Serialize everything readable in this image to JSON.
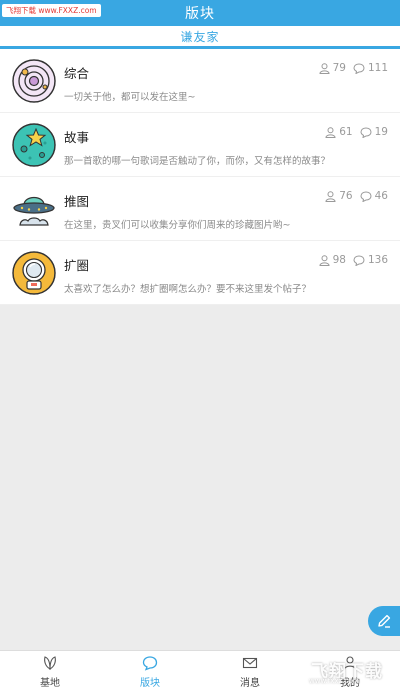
{
  "watermark_top": "飞翔下载 www.FXXZ.com",
  "header": {
    "title": "版块"
  },
  "subheader": {
    "label": "谦友家"
  },
  "boards": [
    {
      "title": "综合",
      "desc": "一切关于他，都可以发在这里~",
      "members": "79",
      "comments": "111",
      "icon": "planet-icon"
    },
    {
      "title": "故事",
      "desc": "那一首歌的哪一句歌词是否触动了你，而你，又有怎样的故事？",
      "members": "61",
      "comments": "19",
      "icon": "star-planet-icon"
    },
    {
      "title": "推图",
      "desc": "在这里，贵叉们可以收集分享你们周来的珍藏图片哟~",
      "members": "76",
      "comments": "46",
      "icon": "ufo-icon"
    },
    {
      "title": "扩圈",
      "desc": "太喜欢了怎么办？想扩圈啊怎么办？要不来这里发个帖子？",
      "members": "98",
      "comments": "136",
      "icon": "astronaut-icon"
    }
  ],
  "tabs": [
    {
      "label": "基地",
      "icon": "leaf-icon"
    },
    {
      "label": "版块",
      "icon": "chat-bubble-icon"
    },
    {
      "label": "消息",
      "icon": "envelope-icon"
    },
    {
      "label": "我的",
      "icon": "person-icon"
    }
  ],
  "active_tab": "版块",
  "watermark_bottom": {
    "brand": "飞翔下载",
    "url": "www.fxxz.com"
  },
  "colors": {
    "primary": "#39a7e2",
    "background": "#ececec"
  }
}
